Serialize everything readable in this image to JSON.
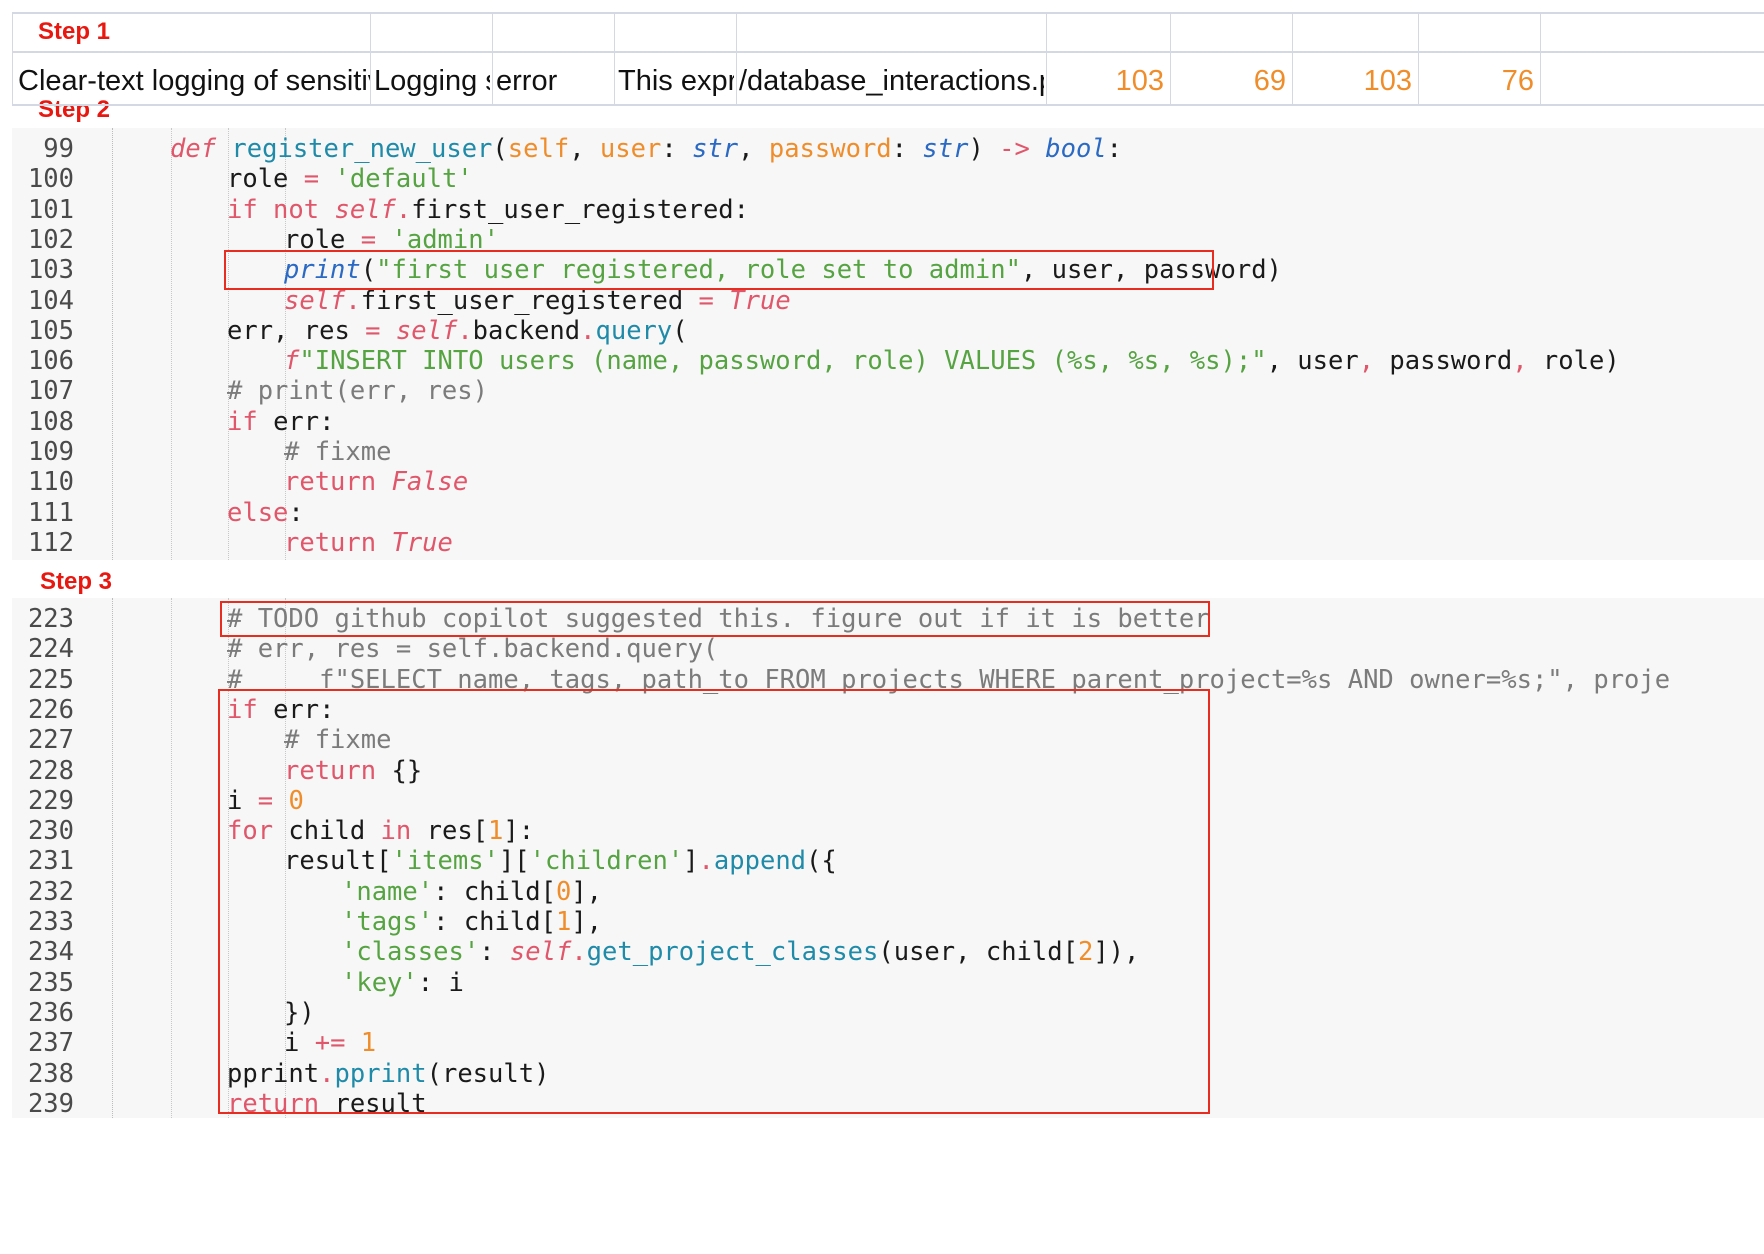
{
  "steps": {
    "step1": "Step 1",
    "step2": "Step 2",
    "step3": "Step 3"
  },
  "sheet_row": [
    "Clear-text logging of sensitive information",
    "Logging sensitive information",
    "error",
    "This expression logs sensitive data (password) as clear text.",
    "/database_interactions.py",
    "103",
    "69",
    "103",
    "76"
  ],
  "code_step2": [
    {
      "ln": "99",
      "indent": 1,
      "tokens": [
        [
          "kwi",
          "def "
        ],
        [
          "fn",
          "register_new_user"
        ],
        [
          "pl",
          "("
        ],
        [
          "param",
          "self"
        ],
        [
          "pl",
          ", "
        ],
        [
          "param",
          "user"
        ],
        [
          "pl",
          ": "
        ],
        [
          "ty",
          "str"
        ],
        [
          "pl",
          ", "
        ],
        [
          "param",
          "password"
        ],
        [
          "pl",
          ": "
        ],
        [
          "ty",
          "str"
        ],
        [
          "pl",
          ") "
        ],
        [
          "op",
          "->"
        ],
        [
          "pl",
          " "
        ],
        [
          "ty",
          "bool"
        ],
        [
          "pl",
          ":"
        ]
      ]
    },
    {
      "ln": "100",
      "indent": 2,
      "tokens": [
        [
          "pl",
          "role "
        ],
        [
          "op",
          "="
        ],
        [
          "pl",
          " "
        ],
        [
          "str",
          "'default'"
        ]
      ]
    },
    {
      "ln": "101",
      "indent": 2,
      "tokens": [
        [
          "kw",
          "if not "
        ],
        [
          "kwi",
          "self"
        ],
        [
          "op",
          "."
        ],
        [
          "pl",
          "first_user_registered:"
        ]
      ]
    },
    {
      "ln": "102",
      "indent": 3,
      "tokens": [
        [
          "pl",
          "role "
        ],
        [
          "op",
          "="
        ],
        [
          "pl",
          " "
        ],
        [
          "str",
          "'admin'"
        ]
      ]
    },
    {
      "ln": "103",
      "indent": 3,
      "tokens": [
        [
          "fni",
          "print"
        ],
        [
          "pl",
          "("
        ],
        [
          "str",
          "\"first user registered, role set to admin\""
        ],
        [
          "pl",
          ", user, password)"
        ]
      ]
    },
    {
      "ln": "104",
      "indent": 3,
      "tokens": [
        [
          "kwi",
          "self"
        ],
        [
          "op",
          "."
        ],
        [
          "pl",
          "first_user_registered "
        ],
        [
          "op",
          "="
        ],
        [
          "pl",
          " "
        ],
        [
          "kwi",
          "True"
        ]
      ]
    },
    {
      "ln": "105",
      "indent": 2,
      "tokens": [
        [
          "pl",
          "err, res "
        ],
        [
          "op",
          "="
        ],
        [
          "pl",
          " "
        ],
        [
          "kwi",
          "self"
        ],
        [
          "op",
          "."
        ],
        [
          "pl",
          "backend"
        ],
        [
          "op",
          "."
        ],
        [
          "fn",
          "query"
        ],
        [
          "pl",
          "("
        ]
      ]
    },
    {
      "ln": "106",
      "indent": 3,
      "tokens": [
        [
          "kwi",
          "f"
        ],
        [
          "str",
          "\"INSERT INTO users (name, password, role) VALUES (%s, %s, %s);\""
        ],
        [
          "pl",
          ", user"
        ],
        [
          "op",
          ","
        ],
        [
          "pl",
          " password"
        ],
        [
          "op",
          ","
        ],
        [
          "pl",
          " role)"
        ]
      ]
    },
    {
      "ln": "107",
      "indent": 2,
      "tokens": [
        [
          "cm",
          "# print(err, res)"
        ]
      ]
    },
    {
      "ln": "108",
      "indent": 2,
      "tokens": [
        [
          "kw",
          "if "
        ],
        [
          "pl",
          "err:"
        ]
      ]
    },
    {
      "ln": "109",
      "indent": 3,
      "tokens": [
        [
          "cm",
          "# fixme"
        ]
      ]
    },
    {
      "ln": "110",
      "indent": 3,
      "tokens": [
        [
          "kw",
          "return "
        ],
        [
          "kwi",
          "False"
        ]
      ]
    },
    {
      "ln": "111",
      "indent": 2,
      "tokens": [
        [
          "kw",
          "else"
        ],
        [
          "pl",
          ":"
        ]
      ]
    },
    {
      "ln": "112",
      "indent": 3,
      "tokens": [
        [
          "kw",
          "return "
        ],
        [
          "kwi",
          "True"
        ]
      ]
    }
  ],
  "code_step3": [
    {
      "ln": "223",
      "indent": 2,
      "tokens": [
        [
          "cm",
          "# TODO github copilot suggested this. figure out if it is better"
        ]
      ]
    },
    {
      "ln": "224",
      "indent": 2,
      "tokens": [
        [
          "cm",
          "# err, res = self.backend.query("
        ]
      ]
    },
    {
      "ln": "225",
      "indent": 2,
      "tokens": [
        [
          "cm",
          "#     f\"SELECT name, tags, path_to FROM projects WHERE parent_project=%s AND owner=%s;\", proje"
        ]
      ]
    },
    {
      "ln": "226",
      "indent": 2,
      "tokens": [
        [
          "kw",
          "if "
        ],
        [
          "pl",
          "err:"
        ]
      ]
    },
    {
      "ln": "227",
      "indent": 3,
      "tokens": [
        [
          "cm",
          "# fixme"
        ]
      ]
    },
    {
      "ln": "228",
      "indent": 3,
      "tokens": [
        [
          "kw",
          "return "
        ],
        [
          "pl",
          "{}"
        ]
      ]
    },
    {
      "ln": "229",
      "indent": 2,
      "tokens": [
        [
          "pl",
          "i "
        ],
        [
          "op",
          "="
        ],
        [
          "pl",
          " "
        ],
        [
          "num",
          "0"
        ]
      ]
    },
    {
      "ln": "230",
      "indent": 2,
      "tokens": [
        [
          "kw",
          "for "
        ],
        [
          "pl",
          "child "
        ],
        [
          "kw",
          "in "
        ],
        [
          "pl",
          "res["
        ],
        [
          "num",
          "1"
        ],
        [
          "pl",
          "]:"
        ]
      ]
    },
    {
      "ln": "231",
      "indent": 3,
      "tokens": [
        [
          "pl",
          "result["
        ],
        [
          "str",
          "'items'"
        ],
        [
          "pl",
          "]["
        ],
        [
          "str",
          "'children'"
        ],
        [
          "pl",
          "]"
        ],
        [
          "op",
          "."
        ],
        [
          "fn",
          "append"
        ],
        [
          "pl",
          "({"
        ]
      ]
    },
    {
      "ln": "232",
      "indent": 4,
      "tokens": [
        [
          "str",
          "'name'"
        ],
        [
          "pl",
          ": child["
        ],
        [
          "num",
          "0"
        ],
        [
          "pl",
          "],"
        ]
      ]
    },
    {
      "ln": "233",
      "indent": 4,
      "tokens": [
        [
          "str",
          "'tags'"
        ],
        [
          "pl",
          ": child["
        ],
        [
          "num",
          "1"
        ],
        [
          "pl",
          "],"
        ]
      ]
    },
    {
      "ln": "234",
      "indent": 4,
      "tokens": [
        [
          "str",
          "'classes'"
        ],
        [
          "pl",
          ": "
        ],
        [
          "kwi",
          "self"
        ],
        [
          "op",
          "."
        ],
        [
          "fn",
          "get_project_classes"
        ],
        [
          "pl",
          "(user, child["
        ],
        [
          "num",
          "2"
        ],
        [
          "pl",
          "]),"
        ]
      ]
    },
    {
      "ln": "235",
      "indent": 4,
      "tokens": [
        [
          "str",
          "'key'"
        ],
        [
          "pl",
          ": i"
        ]
      ]
    },
    {
      "ln": "236",
      "indent": 3,
      "tokens": [
        [
          "pl",
          "})"
        ]
      ]
    },
    {
      "ln": "237",
      "indent": 3,
      "tokens": [
        [
          "pl",
          "i "
        ],
        [
          "op",
          "+="
        ],
        [
          "pl",
          " "
        ],
        [
          "num",
          "1"
        ]
      ]
    },
    {
      "ln": "238",
      "indent": 2,
      "tokens": [
        [
          "pl",
          "pprint"
        ],
        [
          "op",
          "."
        ],
        [
          "fn",
          "pprint"
        ],
        [
          "pl",
          "(result)"
        ]
      ]
    },
    {
      "ln": "239",
      "indent": 2,
      "tokens": [
        [
          "kw",
          "return "
        ],
        [
          "pl",
          "result"
        ]
      ]
    }
  ]
}
